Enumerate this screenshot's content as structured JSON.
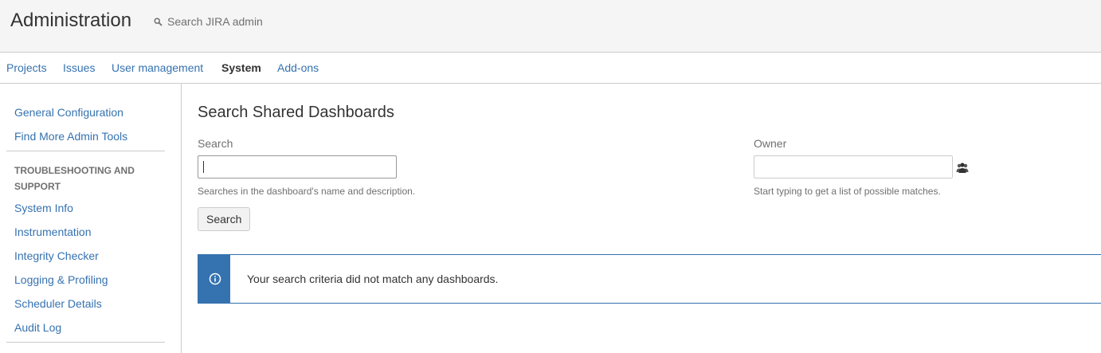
{
  "header": {
    "title": "Administration",
    "search_placeholder": "Search JIRA admin",
    "search_icon": "search-icon"
  },
  "nav": {
    "tabs": [
      {
        "label": "Projects",
        "active": false
      },
      {
        "label": "Issues",
        "active": false
      },
      {
        "label": "User management",
        "active": false
      },
      {
        "label": "System",
        "active": true
      },
      {
        "label": "Add-ons",
        "active": false
      }
    ]
  },
  "sidebar": {
    "top_items": [
      "General Configuration",
      "Find More Admin Tools"
    ],
    "section_heading": "TROUBLESHOOTING AND SUPPORT",
    "section_items": [
      "System Info",
      "Instrumentation",
      "Integrity Checker",
      "Logging & Profiling",
      "Scheduler Details",
      "Audit Log"
    ]
  },
  "main": {
    "page_title": "Search Shared Dashboards",
    "search": {
      "label": "Search",
      "value": "",
      "hint": "Searches in the dashboard's name and description."
    },
    "owner": {
      "label": "Owner",
      "value": "",
      "hint": "Start typing to get a list of possible matches.",
      "picker_icon": "users-icon"
    },
    "search_button": "Search",
    "message": {
      "text": "Your search criteria did not match any dashboards.",
      "icon": "info-icon"
    }
  },
  "colors": {
    "link": "#3572b0",
    "header_bg": "#f5f5f5",
    "border": "#cccccc",
    "message_accent": "#3572b0"
  }
}
